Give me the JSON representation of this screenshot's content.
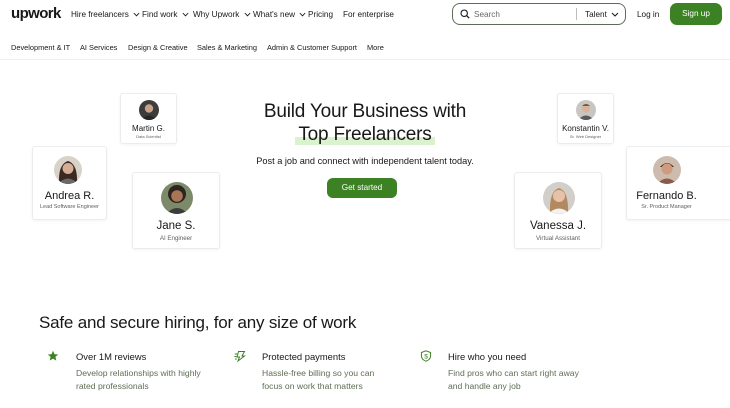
{
  "header": {
    "logo": "upwork",
    "nav": [
      {
        "label": "Hire freelancers",
        "dropdown": true
      },
      {
        "label": "Find work",
        "dropdown": true
      },
      {
        "label": "Why Upwork",
        "dropdown": true
      },
      {
        "label": "What's new",
        "dropdown": true
      },
      {
        "label": "Pricing",
        "dropdown": false
      },
      {
        "label": "For enterprise",
        "dropdown": false
      }
    ],
    "search": {
      "placeholder": "Search",
      "category": "Talent",
      "icon": "search-icon"
    },
    "login_label": "Log in",
    "signup_label": "Sign up"
  },
  "categories": [
    "Development & IT",
    "AI Services",
    "Design & Creative",
    "Sales & Marketing",
    "Admin & Customer Support",
    "More"
  ],
  "hero": {
    "title_line1": "Build Your Business with",
    "title_line2": "Top Freelancers",
    "subtitle": "Post a job and connect with independent talent today.",
    "cta_label": "Get started"
  },
  "freelancers": [
    {
      "name": "Martin G.",
      "role": "Data Scientist"
    },
    {
      "name": "Andrea R.",
      "role": "Lead Software Engineer"
    },
    {
      "name": "Jane S.",
      "role": "AI Engineer"
    },
    {
      "name": "Konstantin V.",
      "role": "Sr. Web Designer"
    },
    {
      "name": "Vanessa J.",
      "role": "Virtual Assistant"
    },
    {
      "name": "Fernando B.",
      "role": "Sr. Product Manager"
    }
  ],
  "hiring": {
    "title": "Safe and secure hiring, for any size of work",
    "features": [
      {
        "icon": "star-icon",
        "title": "Over 1M reviews",
        "desc_line1": "Develop relationships with highly",
        "desc_line2": "rated professionals"
      },
      {
        "icon": "payment-icon",
        "title": "Protected payments",
        "desc_line1": "Hassle-free billing so you can",
        "desc_line2": "focus on work that matters"
      },
      {
        "icon": "shield-icon",
        "title": "Hire who you need",
        "desc_line1": "Find pros who can start right away",
        "desc_line2": "and handle any job"
      }
    ]
  },
  "colors": {
    "brand_green": "#3c8224",
    "text": "#181818",
    "muted": "#5e6d55",
    "highlight": "#d6f0c8"
  }
}
